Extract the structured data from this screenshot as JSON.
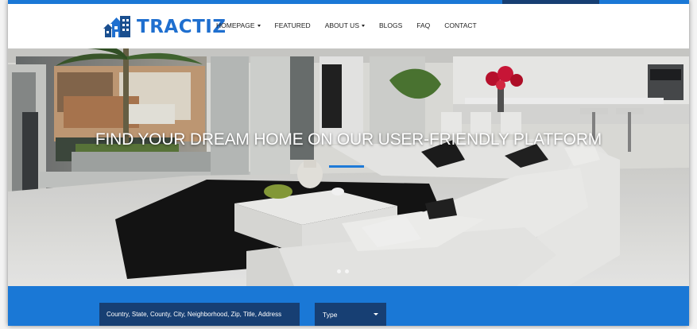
{
  "brand": {
    "name": "TRACTIZ",
    "icon": "house-building-icon",
    "color": "#1f6fcf"
  },
  "nav": {
    "items": [
      {
        "label": "HOMEPAGE",
        "dropdown": true
      },
      {
        "label": "FEATURED",
        "dropdown": false
      },
      {
        "label": "ABOUT US",
        "dropdown": true
      },
      {
        "label": "BLOGS",
        "dropdown": false
      },
      {
        "label": "FAQ",
        "dropdown": false
      },
      {
        "label": "CONTACT",
        "dropdown": false
      }
    ]
  },
  "hero": {
    "title": "FIND YOUR DREAM HOME ON OUR USER-FRIENDLY PLATFORM",
    "slides": 2
  },
  "search": {
    "placeholder": "Country, State, County, City, Neighborhood, Zip, Title, Address",
    "type_label": "Type"
  },
  "colors": {
    "accent": "#1a78d6",
    "dark_accent": "#173f73",
    "nav_text": "#222222"
  }
}
